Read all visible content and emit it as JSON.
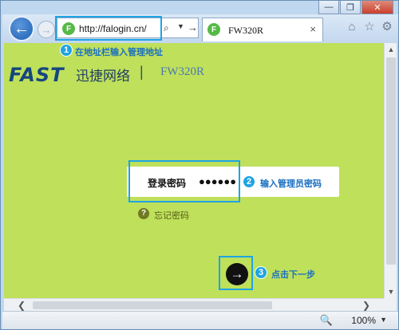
{
  "window": {
    "minimize": "—",
    "restore": "❐",
    "close": "✕"
  },
  "navbar": {
    "back_glyph": "←",
    "forward_glyph": "→",
    "address_url": "http://falogin.cn/",
    "favicon_letter": "F",
    "search_glyph": "⌕",
    "dropdown_glyph": "▼",
    "go_glyph": "→",
    "tab_title": "FW320R",
    "tab_close": "×",
    "icons": {
      "home": "⌂",
      "favorites": "☆",
      "settings": "⚙"
    }
  },
  "page": {
    "logo": "FAST",
    "brand_cn": "迅捷网络",
    "separator": "|",
    "model": "FW320R",
    "step1": {
      "num": "1",
      "text": "在地址栏输入管理地址"
    },
    "password": {
      "label": "登录密码",
      "masked_value": "●●●●●●"
    },
    "step2": {
      "num": "2",
      "text": "输入管理员密码"
    },
    "forgot": {
      "icon": "?",
      "text": "忘记密码"
    },
    "next_glyph": "→",
    "step3": {
      "num": "3",
      "text": "点击下一步"
    }
  },
  "scroll": {
    "up": "▲",
    "down": "▼",
    "left": "❮",
    "right": "❯"
  },
  "status": {
    "zoom_icon": "🔍",
    "zoom": "100%",
    "zoom_drop": "▼"
  },
  "colors": {
    "page_background": "#bfe05a",
    "highlight": "#1ea4e4",
    "brand_blue": "#15467f"
  }
}
